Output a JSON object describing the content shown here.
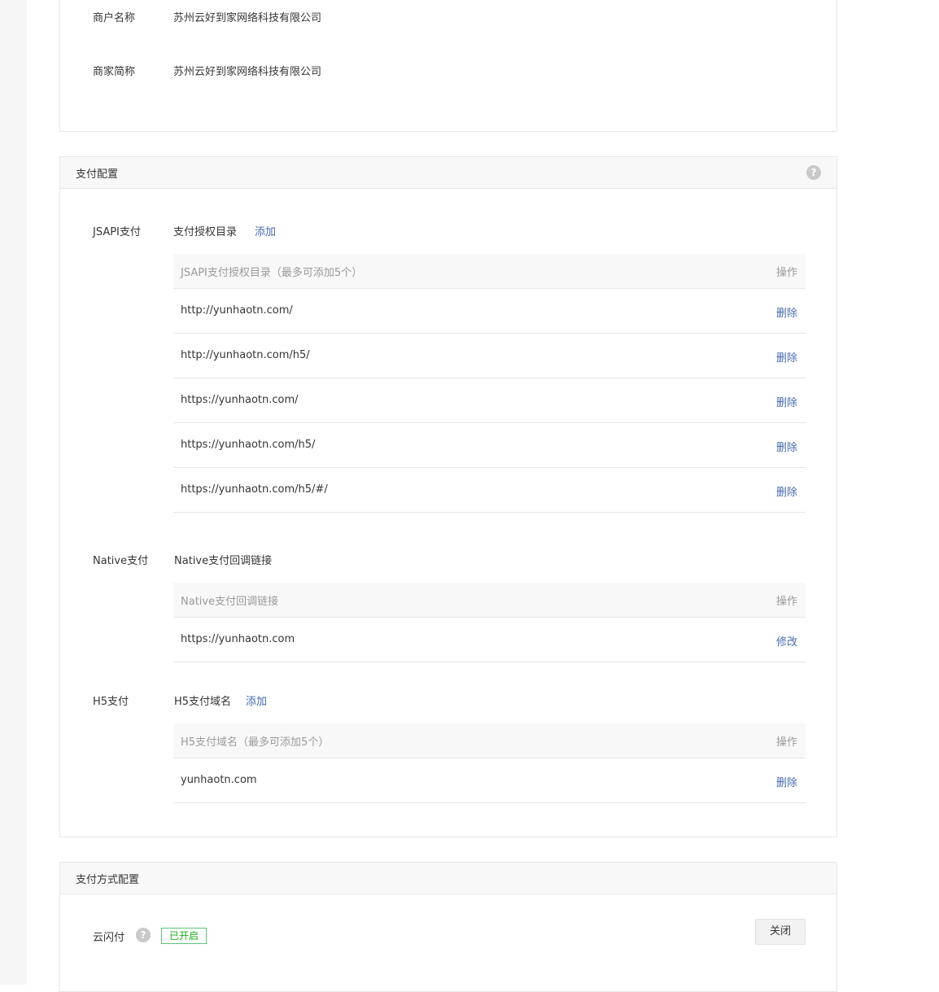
{
  "merchant": {
    "name_label": "商户名称",
    "name_value": "苏州云好到家网络科技有限公司",
    "short_label": "商家简称",
    "short_value": "苏州云好到家网络科技有限公司"
  },
  "payment_config": {
    "title": "支付配置",
    "help_icon": "question-circle-icon",
    "jsapi": {
      "label": "JSAPI支付",
      "sub_label": "支付授权目录",
      "add_link": "添加",
      "table": {
        "header": "JSAPI支付授权目录（最多可添加5个）",
        "action_header": "操作",
        "rows": [
          {
            "url": "http://yunhaotn.com/",
            "action": "删除"
          },
          {
            "url": "http://yunhaotn.com/h5/",
            "action": "删除"
          },
          {
            "url": "https://yunhaotn.com/",
            "action": "删除"
          },
          {
            "url": "https://yunhaotn.com/h5/",
            "action": "删除"
          },
          {
            "url": "https://yunhaotn.com/h5/#/",
            "action": "删除"
          }
        ]
      }
    },
    "native": {
      "label": "Native支付",
      "sub_label": "Native支付回调链接",
      "table": {
        "header": "Native支付回调链接",
        "action_header": "操作",
        "rows": [
          {
            "url": "https://yunhaotn.com",
            "action": "修改"
          }
        ]
      }
    },
    "h5": {
      "label": "H5支付",
      "sub_label": "H5支付域名",
      "add_link": "添加",
      "table": {
        "header": "H5支付域名（最多可添加5个）",
        "action_header": "操作",
        "rows": [
          {
            "url": "yunhaotn.com",
            "action": "删除"
          }
        ]
      }
    }
  },
  "method_config": {
    "title": "支付方式配置",
    "yunshanfu": {
      "label": "云闪付",
      "help_icon": "question-circle-icon",
      "status": "已开启",
      "status_color": "#1aad19",
      "button": "关闭"
    }
  },
  "colors": {
    "link": "#466ab0",
    "border": "#e7e7eb",
    "header_bg": "#f8f8f8"
  }
}
